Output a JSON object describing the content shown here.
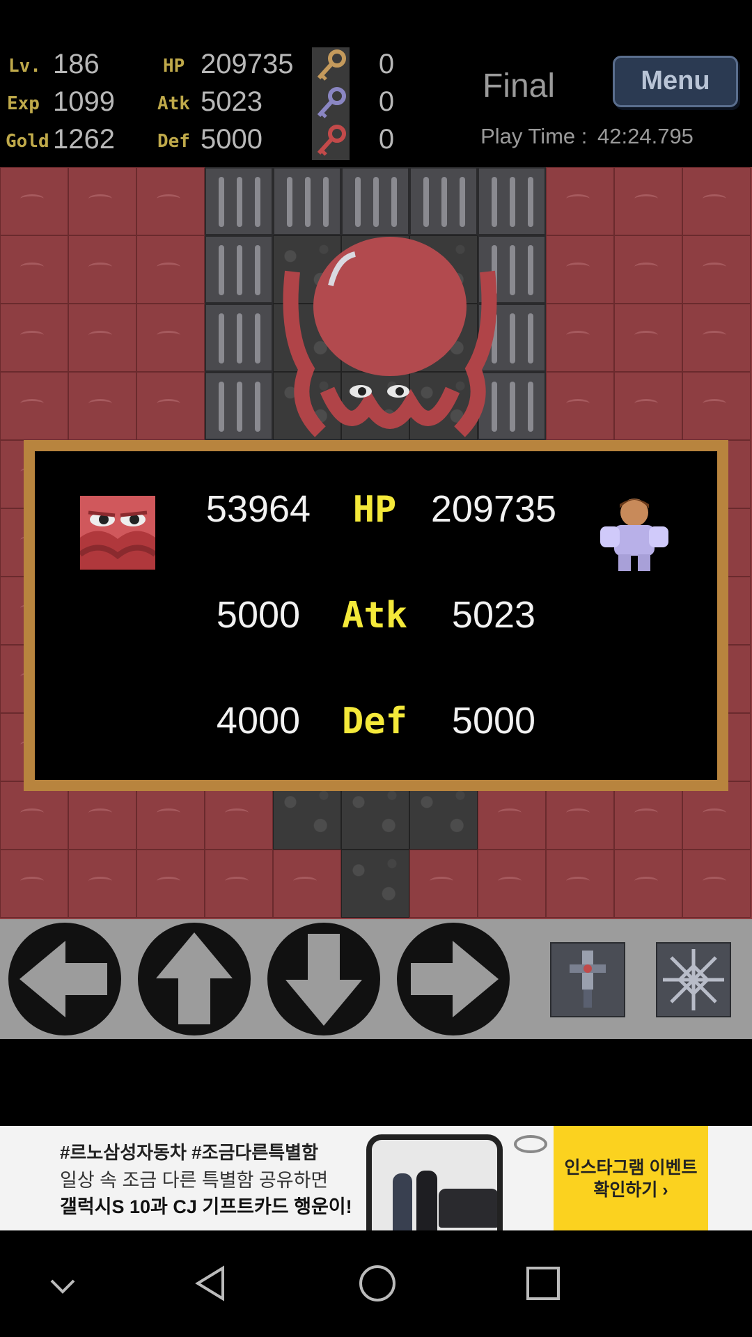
{
  "stats": {
    "level_label": "Lv.",
    "level": "186",
    "exp_label": "Exp",
    "exp": "1099",
    "gold_label": "Gold",
    "gold": "1262",
    "hp_label": "HP",
    "hp": "209735",
    "atk_label": "Atk",
    "atk": "5023",
    "def_label": "Def",
    "def": "5000",
    "keys": [
      {
        "icon": "yellow-key-icon",
        "color": "#c49a5c",
        "count": "0"
      },
      {
        "icon": "blue-key-icon",
        "color": "#8a86c2",
        "count": "0"
      },
      {
        "icon": "red-key-icon",
        "color": "#c24a4a",
        "count": "0"
      }
    ]
  },
  "header": {
    "floor": "Final",
    "menu_label": "Menu",
    "play_time_label": "Play Time :",
    "play_time": "42:24.795"
  },
  "battle": {
    "enemy_icon": "octopus-enemy-icon",
    "hero_icon": "hero-knight-icon",
    "rows": [
      {
        "label": "HP",
        "enemy": "53964",
        "hero": "209735"
      },
      {
        "label": "Atk",
        "enemy": "5000",
        "hero": "5023"
      },
      {
        "label": "Def",
        "enemy": "4000",
        "hero": "5000"
      }
    ]
  },
  "controls": {
    "buttons": [
      "left-arrow-icon",
      "up-arrow-icon",
      "down-arrow-icon",
      "right-arrow-icon"
    ],
    "items": [
      "sword-item-icon",
      "snowflake-item-icon"
    ]
  },
  "ad": {
    "hashtag": "#르노삼성자동차 #조금다른특별함",
    "line2": "일상 속 조금 다른 특별함 공유하면",
    "line3": "갤럭시S 10과 CJ 기프트카드 행운이!",
    "cta_line1": "인스타그램 이벤트",
    "cta_line2": "확인하기 ›",
    "cta_color": "#fbd21f"
  },
  "navbar": {
    "buttons": [
      "hide-keyboard-icon",
      "back-icon",
      "home-icon",
      "recents-icon"
    ]
  },
  "colors": {
    "floor_red": "#8e3e42",
    "battle_border": "#b8843e",
    "battle_label": "#f4e93a"
  }
}
